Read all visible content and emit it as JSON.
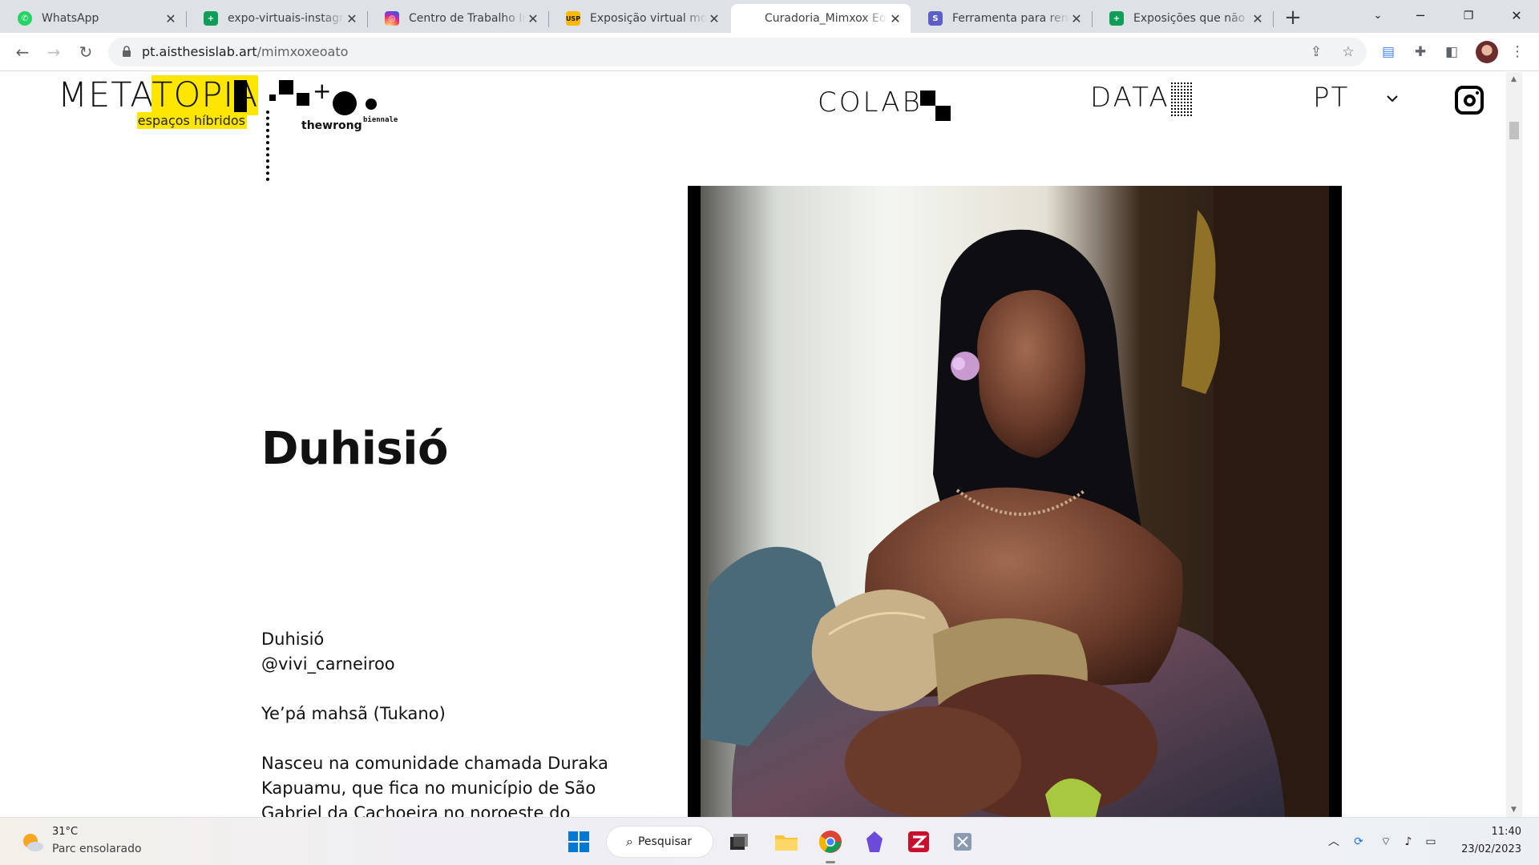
{
  "browser": {
    "tabs": [
      {
        "title": "WhatsApp",
        "favicon": "whatsapp-icon",
        "color": "#25d366",
        "active": false
      },
      {
        "title": "expo-virtuais-instagram",
        "favicon": "google-sheets-icon",
        "color": "#0f9d58",
        "active": false
      },
      {
        "title": "Centro de Trabalho Indígena",
        "favicon": "instagram-icon",
        "color": "#e1306c",
        "active": false
      },
      {
        "title": "Exposição virtual mostra",
        "favicon": "usp-icon",
        "color": "#fcb900",
        "active": false
      },
      {
        "title": "Curadoria_Mimxox Eoato",
        "favicon": "",
        "color": "",
        "active": true
      },
      {
        "title": "Ferramenta para remover",
        "favicon": "app-icon",
        "color": "#5b5fc7",
        "active": false
      },
      {
        "title": "Exposições que não podem",
        "favicon": "google-sheets-icon",
        "color": "#0f9d58",
        "active": false
      }
    ],
    "url_domain": "pt.aisthesislab.art",
    "url_path": "/mimxoxeoato"
  },
  "site": {
    "logo_main_a": "META",
    "logo_main_b": "TOPIA",
    "logo_sub": "espaços híbridos",
    "partner_word": "thewrong",
    "partner_sup": "biennale",
    "nav_colab": "COLAB",
    "nav_data": "DATA",
    "nav_lang": "PT"
  },
  "content": {
    "title": "Duhisió",
    "bio_line1": "Duhisió",
    "bio_line2": "@vivi_carneiroo",
    "bio_line3": "Ye’pá mahsã (Tukano)",
    "bio_line4": "Nasceu na comunidade chamada Duraka",
    "bio_line5": "Kapuamu, que fica no município de São",
    "bio_line6": "Gabriel da Cachoeira no noroeste do"
  },
  "taskbar": {
    "temp": "31°C",
    "weather": "Parc ensolarado",
    "search": "Pesquisar",
    "time": "11:40",
    "date": "23/02/2023"
  }
}
